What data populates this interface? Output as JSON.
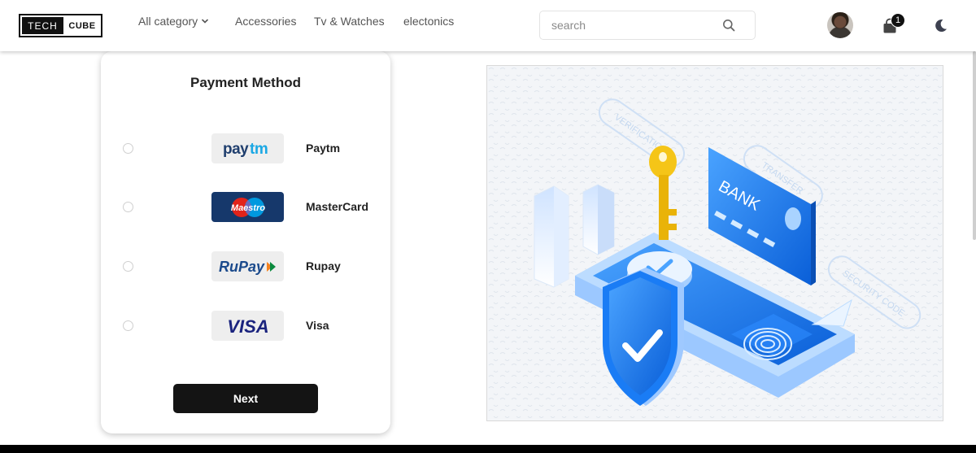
{
  "header": {
    "logo_left": "TECH",
    "logo_right": "CUBE",
    "nav": [
      {
        "label": "All category",
        "has_dropdown": true
      },
      {
        "label": "Accessories"
      },
      {
        "label": "Tv & Watches"
      },
      {
        "label": "electonics"
      }
    ],
    "search_placeholder": "search",
    "cart_count": "1"
  },
  "payment": {
    "title": "Payment Method",
    "options": [
      {
        "name": "Paytm",
        "logo_text": "paytm"
      },
      {
        "name": "MasterCard",
        "logo_text": "Maestro"
      },
      {
        "name": "Rupay",
        "logo_text": "RuPay"
      },
      {
        "name": "Visa",
        "logo_text": "VISA"
      }
    ],
    "next_label": "Next"
  },
  "illustration": {
    "card_text": "BANK",
    "tags": [
      "VERIFICATION",
      "TRANSFER",
      "SECURITY CODE"
    ]
  },
  "colors": {
    "primary_blue": "#1a7cf5",
    "dark_button": "#141414",
    "key_yellow": "#f5c518"
  }
}
